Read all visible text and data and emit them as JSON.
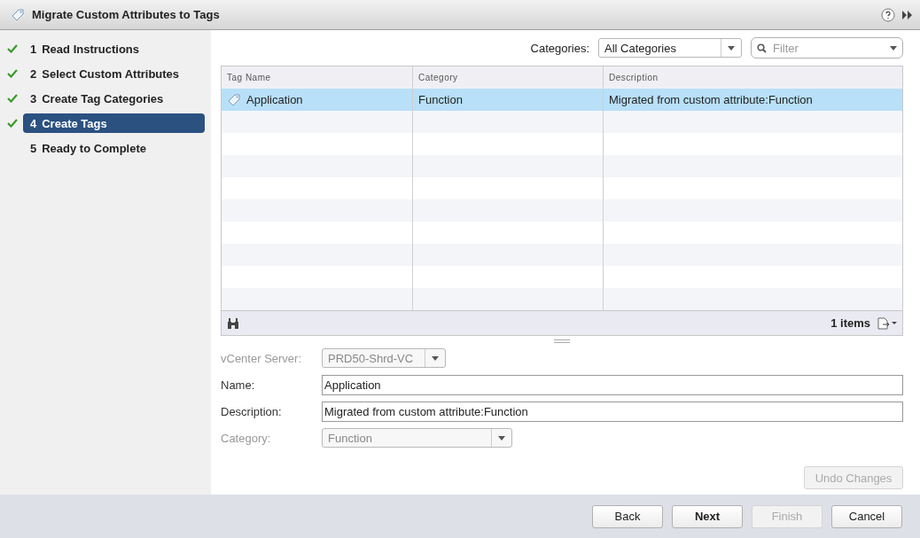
{
  "window": {
    "title": "Migrate Custom Attributes to Tags"
  },
  "steps": [
    {
      "number": "1",
      "label": "Read Instructions",
      "done": true,
      "selected": false
    },
    {
      "number": "2",
      "label": "Select Custom Attributes",
      "done": true,
      "selected": false
    },
    {
      "number": "3",
      "label": "Create Tag Categories",
      "done": true,
      "selected": false
    },
    {
      "number": "4",
      "label": "Create Tags",
      "done": true,
      "selected": true
    },
    {
      "number": "5",
      "label": "Ready to Complete",
      "done": false,
      "selected": false
    }
  ],
  "toolbar": {
    "categories_label": "Categories:",
    "categories_value": "All Categories",
    "filter": {
      "placeholder": "Filter"
    }
  },
  "table": {
    "columns": [
      "Tag Name",
      "Category",
      "Description"
    ],
    "rows": [
      {
        "cells": [
          "Application",
          "Function",
          "Migrated from custom attribute:Function"
        ],
        "selected": true
      }
    ],
    "item_count": "1 items"
  },
  "form": [
    {
      "kind": "select",
      "label": "vCenter Server:",
      "value": "PRD50-Shrd-VC",
      "disabled": true
    },
    {
      "kind": "text",
      "label": "Name:",
      "value": "Application",
      "disabled": false
    },
    {
      "kind": "text",
      "label": "Description:",
      "value": "Migrated from custom attribute:Function",
      "disabled": false
    },
    {
      "kind": "select",
      "label": "Category:",
      "value": "Function",
      "disabled": true
    }
  ],
  "undo_button": {
    "label": "Undo Changes",
    "disabled": true
  },
  "buttons": [
    {
      "label": "Back",
      "disabled": false,
      "primary": false
    },
    {
      "label": "Next",
      "disabled": false,
      "primary": true
    },
    {
      "label": "Finish",
      "disabled": true,
      "primary": false
    },
    {
      "label": "Cancel",
      "disabled": false,
      "primary": false
    }
  ]
}
